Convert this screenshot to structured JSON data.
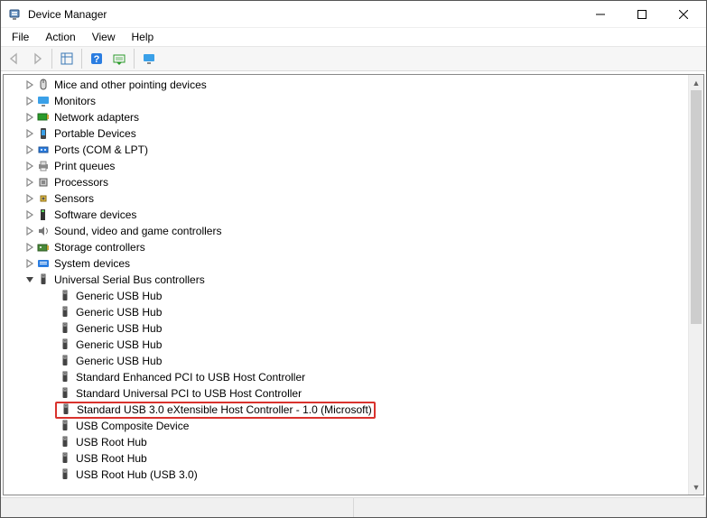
{
  "window": {
    "title": "Device Manager"
  },
  "menu": {
    "file": "File",
    "action": "Action",
    "view": "View",
    "help": "Help"
  },
  "tree": {
    "categories": [
      {
        "icon": "mouse",
        "label": "Mice and other pointing devices",
        "expanded": false
      },
      {
        "icon": "monitor",
        "label": "Monitors",
        "expanded": false
      },
      {
        "icon": "netcard",
        "label": "Network adapters",
        "expanded": false
      },
      {
        "icon": "portable",
        "label": "Portable Devices",
        "expanded": false
      },
      {
        "icon": "ports",
        "label": "Ports (COM & LPT)",
        "expanded": false
      },
      {
        "icon": "printer",
        "label": "Print queues",
        "expanded": false
      },
      {
        "icon": "cpu",
        "label": "Processors",
        "expanded": false
      },
      {
        "icon": "sensor",
        "label": "Sensors",
        "expanded": false
      },
      {
        "icon": "software",
        "label": "Software devices",
        "expanded": false
      },
      {
        "icon": "sound",
        "label": "Sound, video and game controllers",
        "expanded": false
      },
      {
        "icon": "storage",
        "label": "Storage controllers",
        "expanded": false
      },
      {
        "icon": "system",
        "label": "System devices",
        "expanded": false
      },
      {
        "icon": "usb",
        "label": "Universal Serial Bus controllers",
        "expanded": true,
        "children": [
          {
            "icon": "usb",
            "label": "Generic USB Hub"
          },
          {
            "icon": "usb",
            "label": "Generic USB Hub"
          },
          {
            "icon": "usb",
            "label": "Generic USB Hub"
          },
          {
            "icon": "usb",
            "label": "Generic USB Hub"
          },
          {
            "icon": "usb",
            "label": "Generic USB Hub"
          },
          {
            "icon": "usb",
            "label": "Standard Enhanced PCI to USB Host Controller"
          },
          {
            "icon": "usb",
            "label": "Standard Universal PCI to USB Host Controller"
          },
          {
            "icon": "usb",
            "label": "Standard USB 3.0 eXtensible Host Controller - 1.0 (Microsoft)",
            "highlight": true
          },
          {
            "icon": "usb",
            "label": "USB Composite Device"
          },
          {
            "icon": "usb",
            "label": "USB Root Hub"
          },
          {
            "icon": "usb",
            "label": "USB Root Hub"
          },
          {
            "icon": "usb",
            "label": "USB Root Hub (USB 3.0)"
          }
        ]
      }
    ]
  }
}
